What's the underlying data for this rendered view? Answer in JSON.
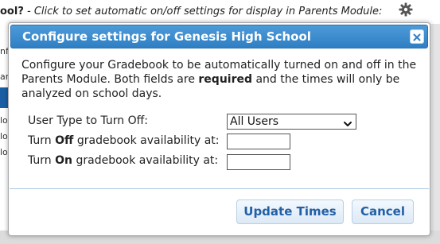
{
  "background": {
    "header_prefix": "ool?",
    "header_hint": " - Click to set automatic on/off settings for display in Parents Module:",
    "left_fragments": [
      "nf",
      "ar",
      "lo",
      "lo",
      "lo"
    ]
  },
  "dialog": {
    "title": "Configure settings for Genesis High School",
    "close_label": "×",
    "intro_part1": "Configure your Gradebook to be automatically turned on and off in the Parents Module. Both fields are ",
    "intro_bold": "required",
    "intro_part2": " and the times will only be analyzed on school days.",
    "user_type_label": "User Type to Turn Off:",
    "user_type_value": "All Users",
    "off_label_pre": "Turn ",
    "off_label_bold": "Off",
    "off_label_post": " gradebook availability at:",
    "off_value": "",
    "on_label_pre": "Turn ",
    "on_label_bold": "On",
    "on_label_post": " gradebook availability at:",
    "on_value": ""
  },
  "buttons": {
    "update": "Update Times",
    "cancel": "Cancel"
  },
  "colors": {
    "titlebar": "#2f7fc4",
    "button_text": "#2260a6"
  },
  "icons": {
    "settings": "gear-icon",
    "close": "close-icon",
    "dropdown": "chevron-down-icon"
  }
}
